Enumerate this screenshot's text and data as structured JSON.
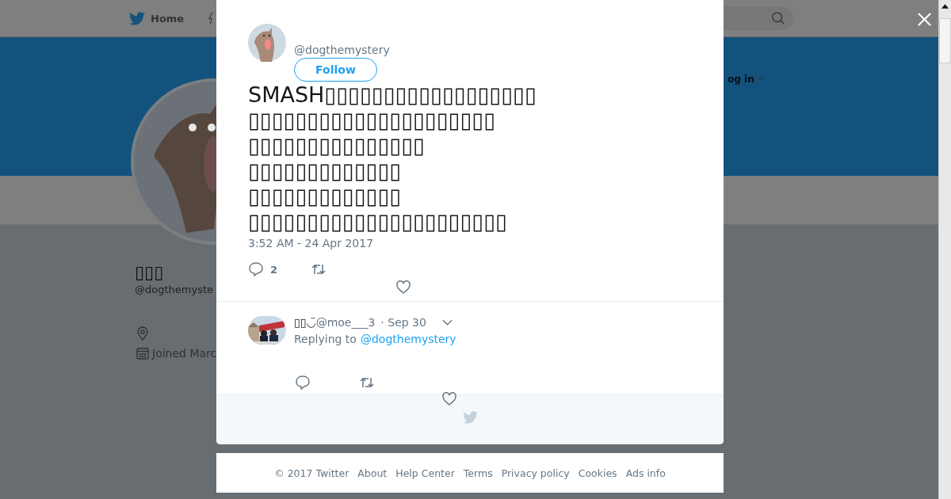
{
  "nav": {
    "home": "Home",
    "login": "og in"
  },
  "profile": {
    "name": "▯▯▯",
    "handle": "@dogthemyste",
    "joined": "Joined Marc"
  },
  "tweet": {
    "handle": "@dogthemystery",
    "follow": "Follow",
    "text": "SMASH▯▯▯▯▯▯▯▯▯▯▯▯▯▯▯▯▯▯\n▯▯▯▯▯▯▯▯▯▯▯▯▯▯▯▯▯▯▯▯▯\n▯▯▯▯▯▯▯▯▯▯▯▯▯▯▯\n▯▯▯▯▯▯▯▯▯▯▯▯▯\n▯▯▯▯▯▯▯▯▯▯▯▯▯\n▯▯▯▯▯▯▯▯▯▯▯▯▯▯▯▯▯▯▯▯▯▯",
    "time": "3:52 AM - 24 Apr 2017",
    "replies": "2"
  },
  "reply": {
    "name": "▯▯◡̈",
    "handle": "@moe___3",
    "date": "· Sep 30",
    "replying_prefix": "Replying to",
    "replying_to": "@dogthemystery"
  },
  "footer": [
    "© 2017 Twitter",
    "About",
    "Help Center",
    "Terms",
    "Privacy policy",
    "Cookies",
    "Ads info"
  ]
}
